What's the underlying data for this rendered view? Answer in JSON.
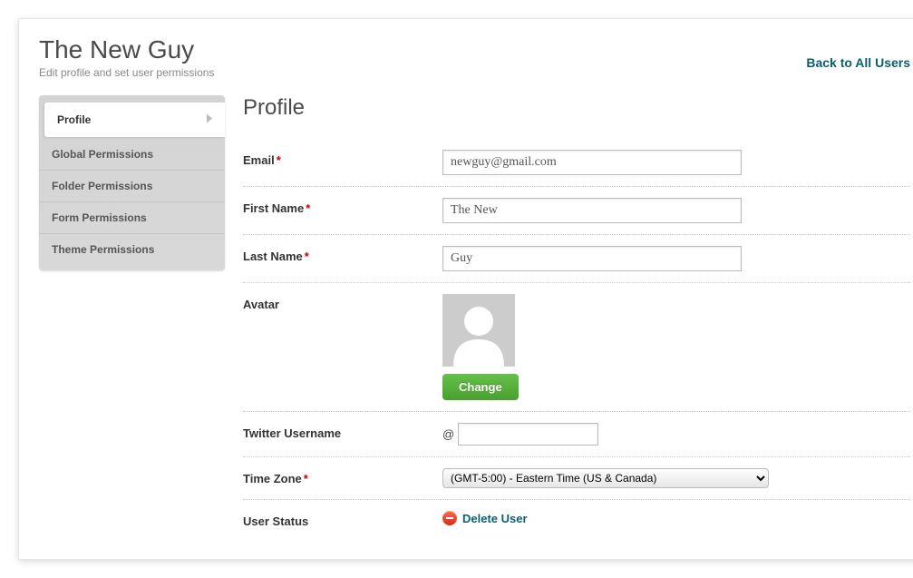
{
  "header": {
    "title": "The New Guy",
    "subtitle": "Edit profile and set user permissions",
    "back_link": "Back to All Users"
  },
  "sidebar": {
    "items": [
      {
        "label": "Profile",
        "active": true
      },
      {
        "label": "Global Permissions",
        "active": false
      },
      {
        "label": "Folder Permissions",
        "active": false
      },
      {
        "label": "Form Permissions",
        "active": false
      },
      {
        "label": "Theme Permissions",
        "active": false
      }
    ]
  },
  "main": {
    "heading": "Profile",
    "fields": {
      "email": {
        "label": "Email",
        "required": true,
        "value": "newguy@gmail.com"
      },
      "first_name": {
        "label": "First Name",
        "required": true,
        "value": "The New"
      },
      "last_name": {
        "label": "Last Name",
        "required": true,
        "value": "Guy"
      },
      "avatar": {
        "label": "Avatar",
        "change_button": "Change"
      },
      "twitter": {
        "label": "Twitter Username",
        "prefix": "@",
        "value": ""
      },
      "timezone": {
        "label": "Time Zone",
        "required": true,
        "selected": "(GMT-5:00) - Eastern Time (US & Canada)"
      },
      "user_status": {
        "label": "User Status",
        "delete_label": "Delete User"
      }
    }
  }
}
